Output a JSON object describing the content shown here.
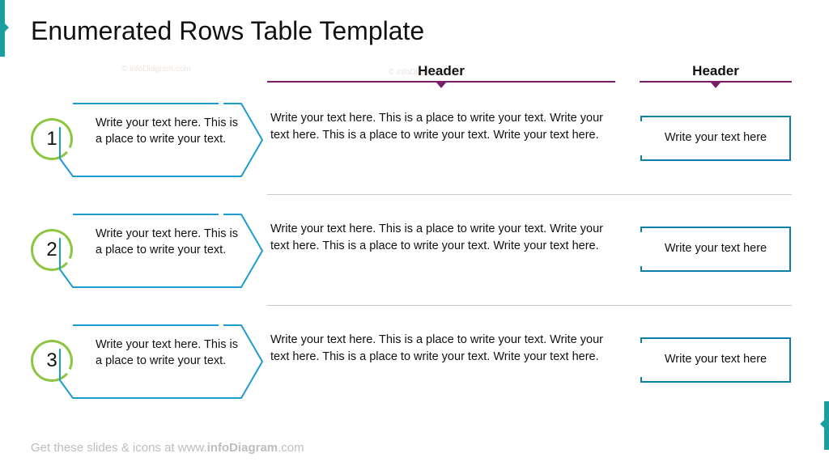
{
  "title": "Enumerated Rows Table Template",
  "headers": {
    "col2": "Header",
    "col3": "Header"
  },
  "rows": [
    {
      "num": "1",
      "col1": "Write your text here. This is a place to write your text.",
      "col2": "Write your text here. This is a place to write your text. Write your text here. This is a place to write your text. Write your text here.",
      "col3": "Write your text here"
    },
    {
      "num": "2",
      "col1": "Write your text here. This is a place to write your text.",
      "col2": "Write your text here. This is a place to write your text. Write your text here. This is a place to write your text. Write your text here.",
      "col3": "Write your text here"
    },
    {
      "num": "3",
      "col1": "Write your text here. This is a place to write your text.",
      "col2": "Write your text here. This is a place to write your text. Write your text here. This is a place to write your text. Write your text here.",
      "col3": "Write your text here"
    }
  ],
  "footer_prefix": "Get these slides & icons at www.",
  "footer_bold": "infoDiagram",
  "footer_suffix": ".com",
  "watermark": "© infoDiagram.com",
  "colors": {
    "teal": "#1a9e9e",
    "blue": "#1e9bd1",
    "purple": "#7a1d6d",
    "green": "#8cc63f"
  }
}
